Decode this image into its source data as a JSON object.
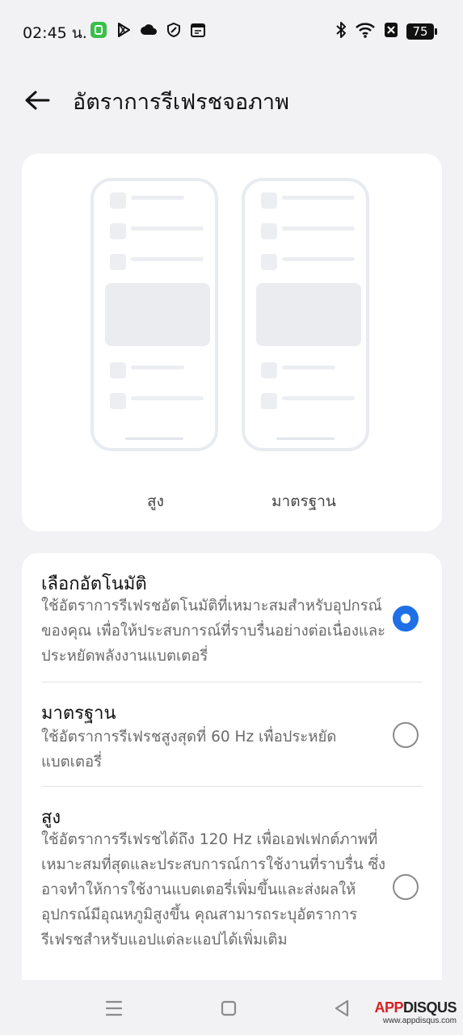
{
  "status_bar": {
    "time": "02:45 น.",
    "battery": "75",
    "icons_left": [
      "app-notification-icon",
      "play-store-icon",
      "cloud-icon",
      "shield-icon",
      "calendar-icon"
    ],
    "icons_right": [
      "bluetooth-icon",
      "wifi-icon",
      "sim-off-icon",
      "battery-icon"
    ]
  },
  "header": {
    "title": "อัตราการรีเฟรชจอภาพ"
  },
  "preview": {
    "high_label": "สูง",
    "standard_label": "มาตรฐาน"
  },
  "options": [
    {
      "title": "เลือกอัตโนมัติ",
      "description": "ใช้อัตราการรีเฟรชอัตโนมัติที่เหมาะสมสำหรับอุปกรณ์ของคุณ เพื่อให้ประสบการณ์ที่ราบรื่นอย่างต่อเนื่องและประหยัดพลังงานแบตเตอรี่",
      "selected": true
    },
    {
      "title": "มาตรฐาน",
      "description": "ใช้อัตราการรีเฟรชสูงสุดที่ 60 Hz เพื่อประหยัดแบตเตอรี่",
      "selected": false
    },
    {
      "title": "สูง",
      "description": "ใช้อัตราการรีเฟรชได้ถึง 120 Hz เพื่อเอฟเฟกต์ภาพที่เหมาะสมที่สุดและประสบการณ์การใช้งานที่ราบรื่น ซึ่งอาจทำให้การใช้งานแบตเตอรี่เพิ่มขึ้นและส่งผลให้อุปกรณ์มีอุณหภูมิสูงขึ้น คุณสามารถระบุอัตราการรีเฟรชสำหรับแอปแต่ละแอปได้เพิ่มเติม",
      "selected": false
    }
  ],
  "accent_color": "#1f6fe6",
  "watermark": {
    "brand_a": "APP",
    "brand_b": "DISQUS",
    "url": "www.appdisqus.com"
  }
}
